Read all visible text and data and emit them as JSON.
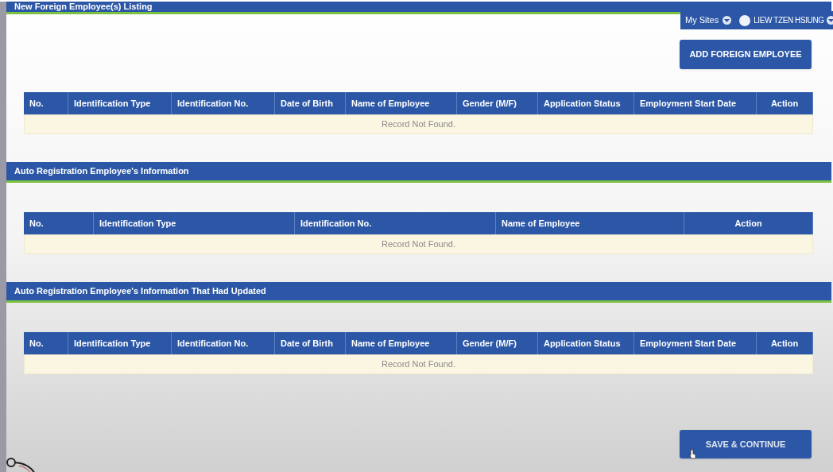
{
  "header": {
    "title": "New Foreign Employee(s) Listing"
  },
  "user_bar": {
    "sites_label": "My Sites",
    "user_name": "LIEW TZEN HSIUNG"
  },
  "add_button": "ADD FOREIGN EMPLOYEE",
  "sections": [
    {
      "table": {
        "columns": [
          "No.",
          "Identification Type",
          "Identification No.",
          "Date of Birth",
          "Name of Employee",
          "Gender (M/F)",
          "Application Status",
          "Employment Start Date",
          "Action"
        ],
        "empty_message": "Record Not Found."
      }
    },
    {
      "title": "Auto Registration Employee's Information",
      "table": {
        "columns": [
          "No.",
          "Identification Type",
          "Identification No.",
          "Name of Employee",
          "Action"
        ],
        "empty_message": "Record Not Found."
      }
    },
    {
      "title": "Auto Registration Employee's Information That Had Updated",
      "table": {
        "columns": [
          "No.",
          "Identification Type",
          "Identification No.",
          "Date of Birth",
          "Name of Employee",
          "Gender (M/F)",
          "Application Status",
          "Employment Start Date",
          "Action"
        ],
        "empty_message": "Record Not Found."
      }
    }
  ],
  "save_button": "SAVE & CONTINUE"
}
